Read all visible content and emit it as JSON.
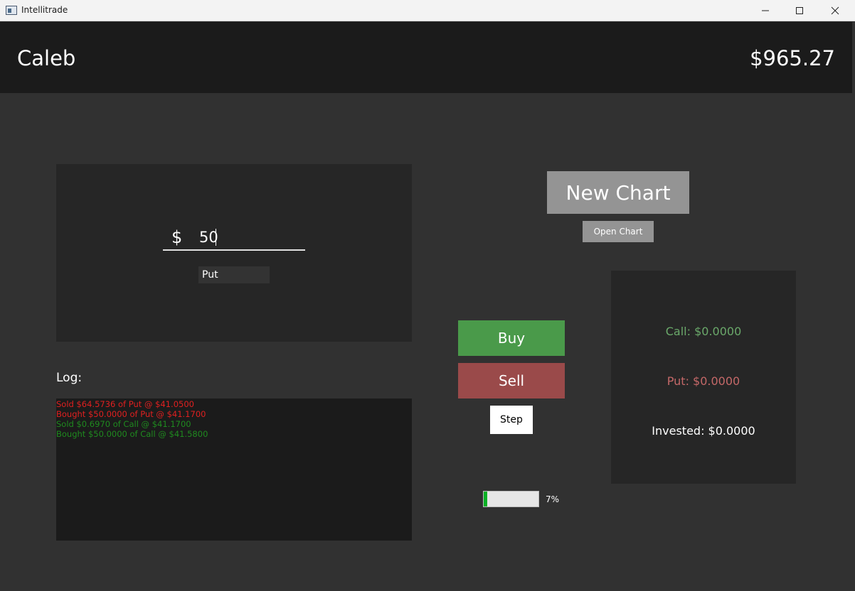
{
  "window": {
    "title": "Intellitrade",
    "controls": {
      "minimize": "—",
      "maximize": "☐",
      "close": "✕"
    }
  },
  "header": {
    "user_name": "Caleb",
    "balance": "$965.27"
  },
  "order": {
    "currency_symbol": "$",
    "amount": "50",
    "option_type": "Put"
  },
  "log": {
    "label": "Log:",
    "entries": [
      {
        "text": "Sold $64.5736 of Put @ $41.0500",
        "type": "put"
      },
      {
        "text": "Bought $50.0000 of Put @ $41.1700",
        "type": "put"
      },
      {
        "text": "Sold $0.6970 of Call @ $41.1700",
        "type": "call"
      },
      {
        "text": "Bought $50.0000 of Call @ $41.5800",
        "type": "call"
      }
    ]
  },
  "chart_controls": {
    "new_chart_label": "New Chart",
    "open_chart_label": "Open Chart"
  },
  "trade": {
    "buy_label": "Buy",
    "sell_label": "Sell",
    "step_label": "Step"
  },
  "progress": {
    "value_percent": 7,
    "label": "7%"
  },
  "positions": {
    "call": "Call: $0.0000",
    "put": "Put: $0.0000",
    "invested": "Invested: $0.0000"
  },
  "colors": {
    "buy": "#4a9a4a",
    "sell": "#9a4a4a",
    "call_text": "#6aa86a",
    "put_text": "#c46868",
    "log_put": "#e02020",
    "log_call": "#1f8a1f",
    "progress_fill": "#06b025"
  }
}
